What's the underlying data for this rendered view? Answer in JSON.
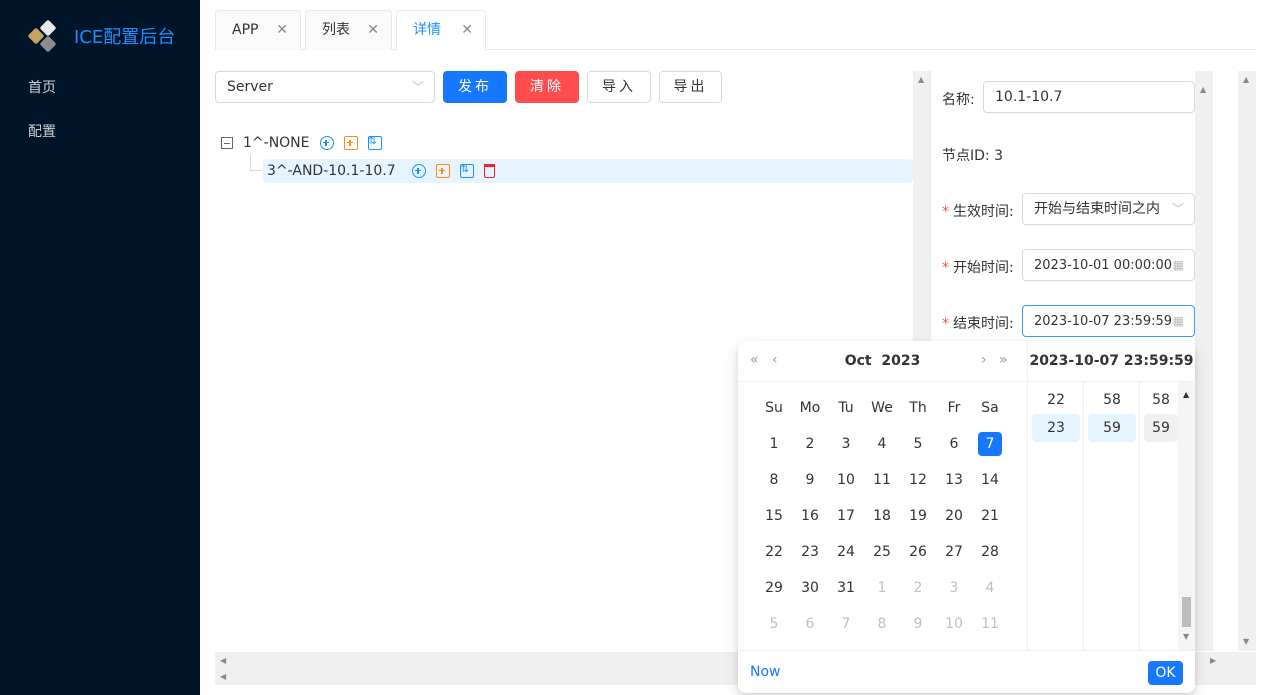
{
  "app": {
    "title": "ICE配置后台"
  },
  "sidebar": {
    "items": [
      {
        "label": "首页"
      },
      {
        "label": "配置"
      }
    ]
  },
  "tabs": [
    {
      "label": "APP",
      "close": "✕"
    },
    {
      "label": "列表",
      "close": "✕"
    },
    {
      "label": "详情",
      "close": "✕",
      "active": true
    }
  ],
  "toolbar": {
    "select_value": "Server",
    "publish_label": "发布",
    "clear_label": "清除",
    "import_label": "导入",
    "export_label": "导出"
  },
  "tree": {
    "root": {
      "label": "1^-NONE"
    },
    "child": {
      "label": "3^-AND-10.1-10.7"
    }
  },
  "form": {
    "name_label": "名称:",
    "name_value": "10.1-10.7",
    "node_id_label": "节点ID:",
    "node_id_value": "3",
    "effect_label": "生效时间:",
    "effect_value": "开始与结束时间之内",
    "start_label": "开始时间:",
    "start_value": "2023-10-01 00:00:00",
    "end_label": "结束时间:",
    "end_value": "2023-10-07 23:59:59",
    "required_mark": "*"
  },
  "datepicker": {
    "month": "Oct",
    "year": "2023",
    "nav": {
      "prev_year": "«",
      "prev_month": "‹",
      "next_month": "›",
      "next_year": "»"
    },
    "weekdays": [
      "Su",
      "Mo",
      "Tu",
      "We",
      "Th",
      "Fr",
      "Sa"
    ],
    "weeks": [
      [
        "1",
        "2",
        "3",
        "4",
        "5",
        "6",
        "7"
      ],
      [
        "8",
        "9",
        "10",
        "11",
        "12",
        "13",
        "14"
      ],
      [
        "15",
        "16",
        "17",
        "18",
        "19",
        "20",
        "21"
      ],
      [
        "22",
        "23",
        "24",
        "25",
        "26",
        "27",
        "28"
      ],
      [
        "29",
        "30",
        "31",
        "1",
        "2",
        "3",
        "4"
      ],
      [
        "5",
        "6",
        "7",
        "8",
        "9",
        "10",
        "11"
      ]
    ],
    "selected_day": "7",
    "time_display": "2023-10-07 23:59:59",
    "hours": [
      "22",
      "23"
    ],
    "minutes": [
      "58",
      "59"
    ],
    "seconds": [
      "58",
      "59"
    ],
    "now_label": "Now",
    "ok_label": "OK"
  },
  "colors": {
    "primary": "#1677ff",
    "danger": "#ff4d4f",
    "sidebar_bg": "#001529"
  }
}
